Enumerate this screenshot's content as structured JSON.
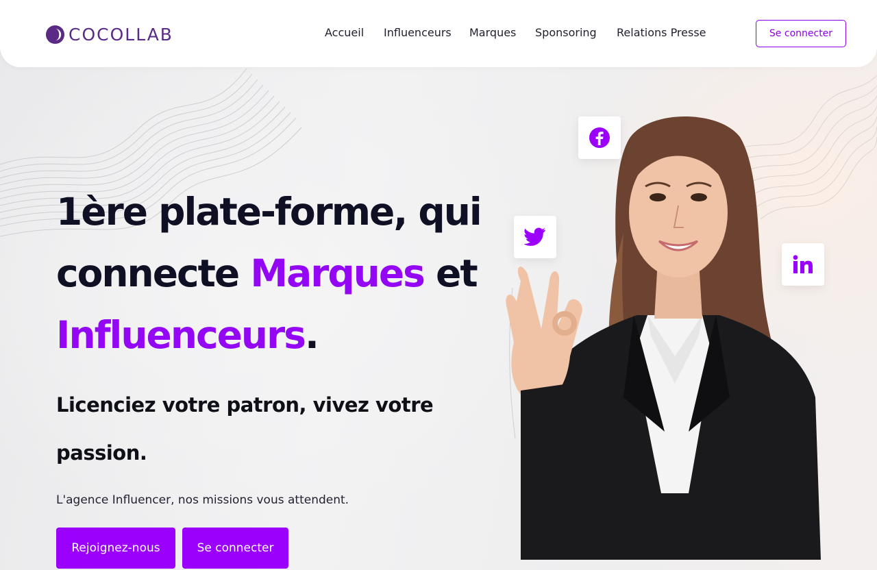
{
  "brand": {
    "name": "COCOLLAB",
    "logo_icon": "half-moon-circle-icon",
    "color": "#5b2a86"
  },
  "nav": {
    "items": [
      {
        "label": "Accueil"
      },
      {
        "label": "Influenceurs"
      },
      {
        "label": "Marques"
      },
      {
        "label": "Sponsoring"
      },
      {
        "label": "Relations Presse"
      }
    ],
    "login_label": "Se connecter"
  },
  "hero": {
    "headline_part1": "1ère plate-forme, qui",
    "headline_part2": "connecte ",
    "headline_accent1": "Marques",
    "headline_part3": " et",
    "headline_accent2": "Influenceurs",
    "headline_end": ".",
    "subhead_line1": "Licenciez votre patron, vivez votre",
    "subhead_line2": "passion.",
    "tagline": "L'agence Influencer, nos missions vous attendent.",
    "cta_join": "Rejoignez-nous",
    "cta_login": "Se connecter"
  },
  "social": {
    "facebook_icon": "facebook-icon",
    "twitter_icon": "twitter-icon",
    "linkedin_icon": "linkedin-icon"
  },
  "colors": {
    "accent": "#9a00fb",
    "heading": "#0f1024",
    "background": "#ececed"
  }
}
